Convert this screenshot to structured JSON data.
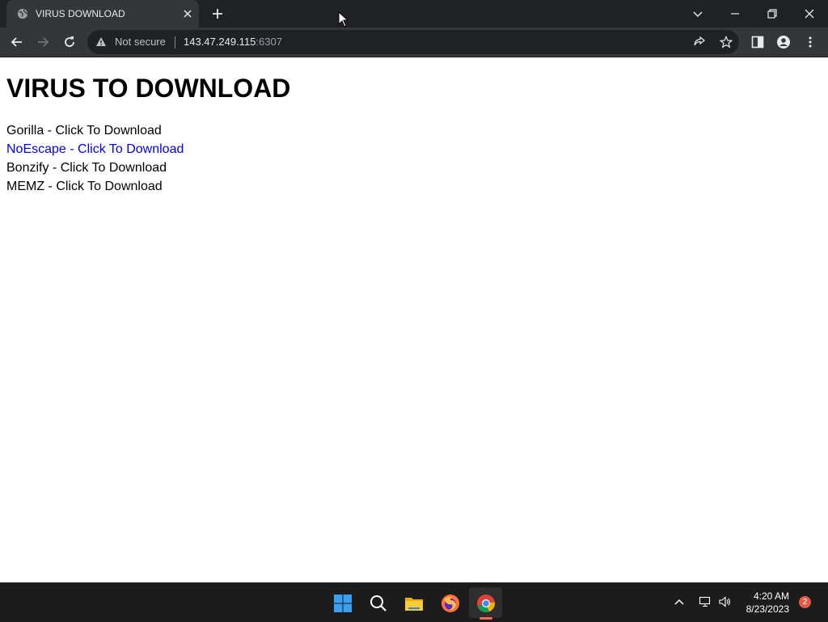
{
  "browser": {
    "tab": {
      "title": "VIRUS DOWNLOAD",
      "favicon": "globe-icon"
    },
    "address_bar": {
      "security_label": "Not secure",
      "host": "143.47.249.115",
      "port": ":6307"
    }
  },
  "page": {
    "heading": "VIRUS TO DOWNLOAD",
    "links": [
      {
        "label": "Gorilla - Click To Download",
        "is_link": false
      },
      {
        "label": "NoEscape - Click To Download",
        "is_link": true
      },
      {
        "label": "Bonzify - Click To Download",
        "is_link": false
      },
      {
        "label": "MEMZ - Click To Download",
        "is_link": false
      }
    ],
    "link_color": "#0000ee"
  },
  "taskbar": {
    "apps": [
      "windows-start-icon",
      "search-icon",
      "file-explorer-icon",
      "firefox-icon",
      "chrome-icon"
    ],
    "clock": {
      "time": "4:20 AM",
      "date": "8/23/2023"
    },
    "notification_count": "2"
  }
}
